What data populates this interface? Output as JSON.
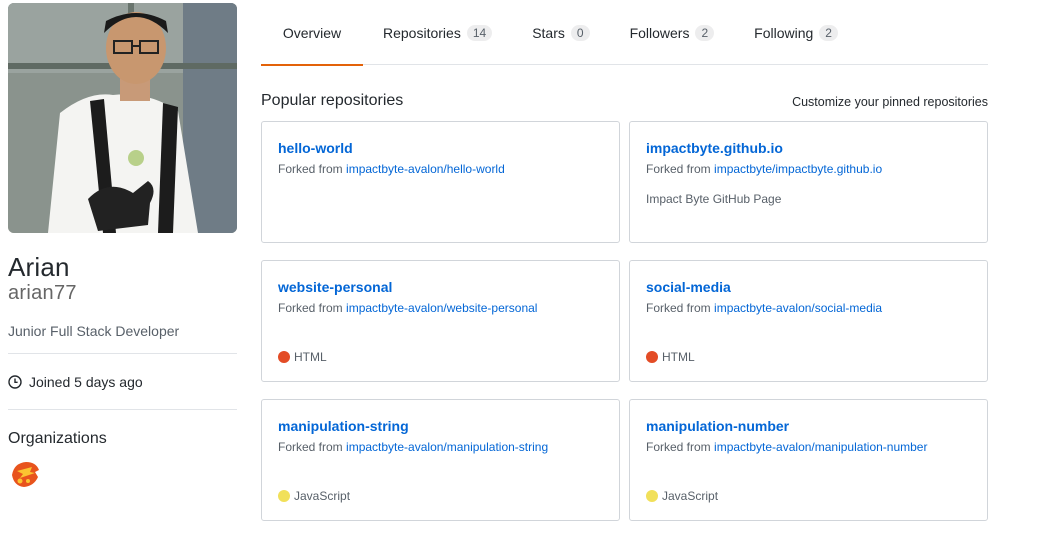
{
  "profile": {
    "full_name": "Arian",
    "username": "arian77",
    "bio": "Junior Full Stack Developer",
    "joined": "Joined 5 days ago",
    "organizations_title": "Organizations"
  },
  "tabs": [
    {
      "label": "Overview",
      "count": null,
      "selected": true
    },
    {
      "label": "Repositories",
      "count": "14"
    },
    {
      "label": "Stars",
      "count": "0"
    },
    {
      "label": "Followers",
      "count": "2"
    },
    {
      "label": "Following",
      "count": "2"
    }
  ],
  "popular": {
    "title": "Popular repositories",
    "customize_label": "Customize your pinned repositories"
  },
  "forked_prefix": "Forked from",
  "repos": [
    {
      "name": "hello-world",
      "forked_from": "impactbyte-avalon/hello-world",
      "description": "",
      "language": "",
      "language_color": ""
    },
    {
      "name": "impactbyte.github.io",
      "forked_from": "impactbyte/impactbyte.github.io",
      "description": "Impact Byte GitHub Page",
      "language": "",
      "language_color": ""
    },
    {
      "name": "website-personal",
      "forked_from": "impactbyte-avalon/website-personal",
      "description": "",
      "language": "HTML",
      "language_color": "#e34c26"
    },
    {
      "name": "social-media",
      "forked_from": "impactbyte-avalon/social-media",
      "description": "",
      "language": "HTML",
      "language_color": "#e34c26"
    },
    {
      "name": "manipulation-string",
      "forked_from": "impactbyte-avalon/manipulation-string",
      "description": "",
      "language": "JavaScript",
      "language_color": "#f1e05a"
    },
    {
      "name": "manipulation-number",
      "forked_from": "impactbyte-avalon/manipulation-number",
      "description": "",
      "language": "JavaScript",
      "language_color": "#f1e05a"
    }
  ],
  "icons": {
    "joined": "clock-icon",
    "organization": "org-logo-icon"
  }
}
